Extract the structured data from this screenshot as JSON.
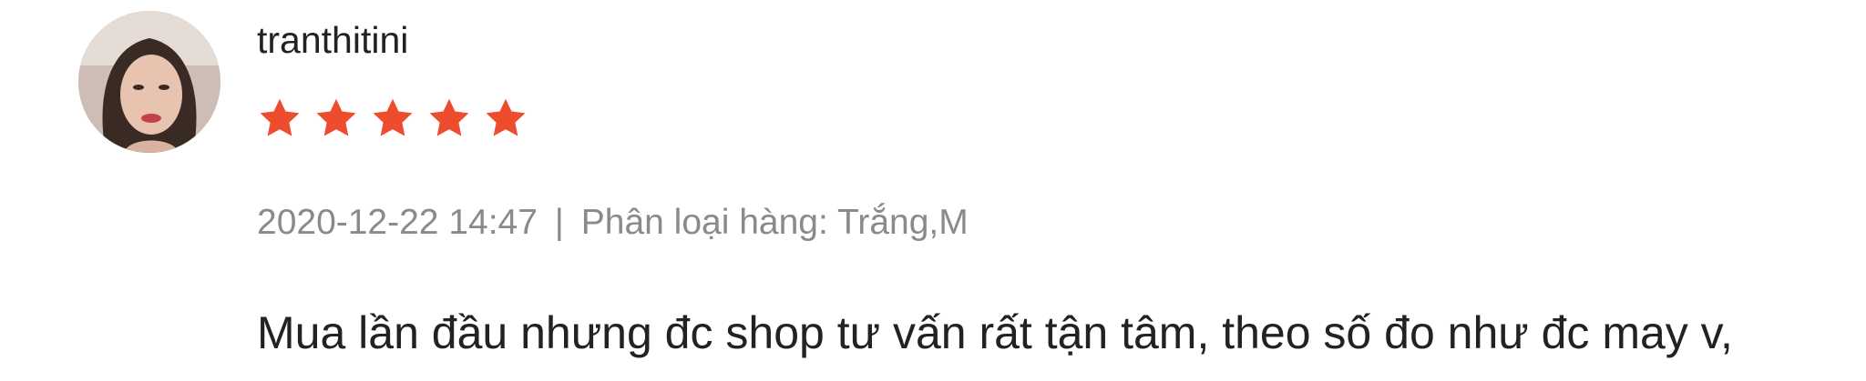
{
  "review": {
    "username": "tranthitini",
    "rating": 5,
    "rating_max": 5,
    "star_color": "#ee4d2d",
    "date": "2020-12-22 14:47",
    "separator": "|",
    "variation_label": "Phân loại hàng:",
    "variation_value": "Trắng,M",
    "comment": "Mua lần đầu nhưng đc shop tư vấn rất tận tâm, theo số đo như đc may v,"
  }
}
